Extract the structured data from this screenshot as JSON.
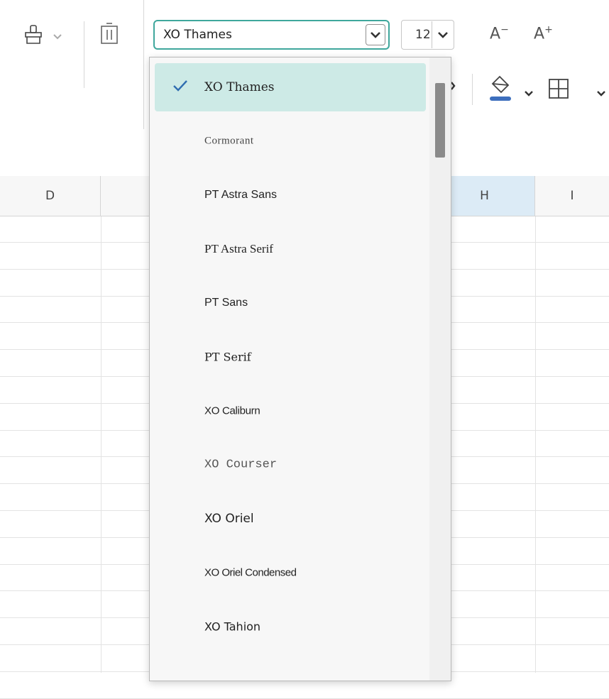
{
  "toolbar": {
    "font_select": {
      "value": "XO Thames"
    },
    "font_size_select": {
      "value": "12"
    },
    "decrease_font_size": {
      "glyph": "A",
      "sup": "−"
    },
    "increase_font_size": {
      "glyph": "A",
      "sup": "+"
    },
    "icons": [
      "paint-format-icon",
      "clear-icon",
      "fill-color-icon",
      "borders-icon"
    ]
  },
  "sheet": {
    "column_headers": [
      {
        "label": "D",
        "selected": false
      },
      {
        "label": "",
        "selected": false
      },
      {
        "label": "H",
        "selected": true
      },
      {
        "label": "I",
        "selected": false
      }
    ]
  },
  "font_dropdown": {
    "items": [
      {
        "label": "XO Thames",
        "selected": true
      },
      {
        "label": "Cormorant",
        "selected": false
      },
      {
        "label": "PT Astra Sans",
        "selected": false
      },
      {
        "label": "PT Astra Serif",
        "selected": false
      },
      {
        "label": "PT Sans",
        "selected": false
      },
      {
        "label": "PT Serif",
        "selected": false
      },
      {
        "label": "XO Caliburn",
        "selected": false
      },
      {
        "label": "XO Courser",
        "selected": false
      },
      {
        "label": "XO Oriel",
        "selected": false
      },
      {
        "label": "XO Oriel Condensed",
        "selected": false
      },
      {
        "label": "XO Tahion",
        "selected": false
      }
    ]
  },
  "colors": {
    "accent": "#3fa79c",
    "selected_item_bg": "#cdeae6",
    "selected_column_bg": "#dcebf6",
    "fill_color_bar": "#3d6fbd"
  }
}
